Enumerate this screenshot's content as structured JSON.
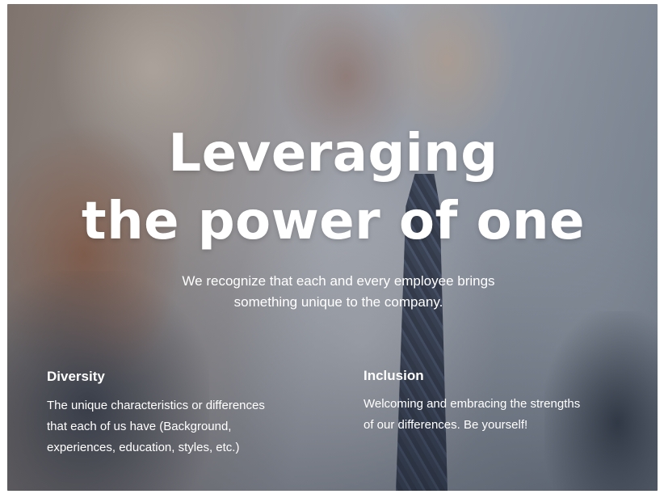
{
  "hero": {
    "headline_line1": "Leveraging",
    "headline_line2": "the power of one",
    "subtitle_line1": "We recognize that each and every employee brings",
    "subtitle_line2": "something unique to the company."
  },
  "columns": [
    {
      "title": "Diversity",
      "lines": [
        "The unique characteristics or differences",
        "that each of us have (Background,",
        "experiences, education, styles, etc.)"
      ]
    },
    {
      "title": "Inclusion",
      "lines": [
        "Welcoming and embracing the strengths",
        "of our differences. Be yourself!"
      ]
    }
  ],
  "colors": {
    "text": "#ffffff",
    "overlay": "#3c3c48"
  }
}
